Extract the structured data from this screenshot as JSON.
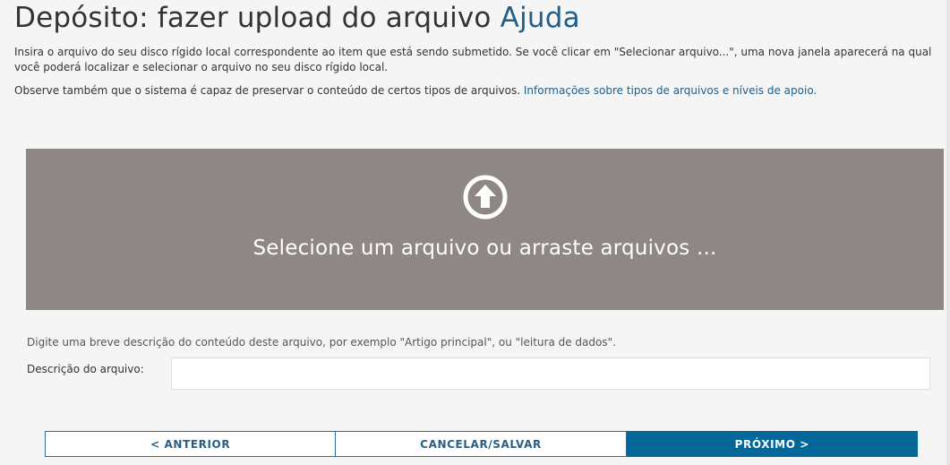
{
  "header": {
    "title": "Depósito: fazer upload do arquivo",
    "help_link": "Ajuda"
  },
  "intro": {
    "paragraph1": "Insira o arquivo do seu disco rígido local correspondente ao item que está sendo submetido. Se você clicar em \"Selecionar arquivo...\", uma nova janela aparecerá na qual você poderá localizar e selecionar o arquivo no seu disco rígido local.",
    "paragraph2_text": "Observe também que o sistema é capaz de preservar o conteúdo de certos tipos de arquivos. ",
    "paragraph2_link": "Informações sobre tipos de arquivos e níveis de apoio."
  },
  "dropzone": {
    "label": "Selecione um arquivo ou arraste arquivos ...",
    "icon": "upload-arrow-circle-icon",
    "background": "#8f8785"
  },
  "description": {
    "hint": "Digite uma breve descrição do conteúdo deste arquivo, por exemplo \"Artigo principal\", ou \"leitura de dados\".",
    "label": "Descrição do arquivo:",
    "value": ""
  },
  "navigation": {
    "previous": "< ANTERIOR",
    "cancel_save": "CANCELAR/SALVAR",
    "next": "PRÓXIMO >"
  },
  "colors": {
    "link": "#1f5f8b",
    "primary_button": "#03679a"
  }
}
